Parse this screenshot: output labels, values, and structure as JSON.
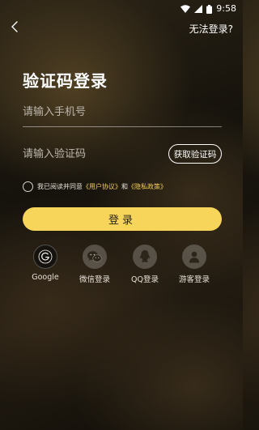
{
  "status_bar": {
    "time": "9:58"
  },
  "header": {
    "back_icon": "chevron-left-icon",
    "cant_login": "无法登录?"
  },
  "title": "验证码登录",
  "phone": {
    "placeholder": "请输入手机号",
    "value": ""
  },
  "code": {
    "placeholder": "请输入验证码",
    "value": "",
    "get_code_label": "获取验证码"
  },
  "agreement": {
    "checked": false,
    "prefix": "我已阅读并同意",
    "user_agreement": "《用户协议》",
    "and": "和",
    "privacy_policy": "《隐私政策》"
  },
  "login_button": "登录",
  "social_logins": [
    {
      "label": "Google",
      "icon": "google-icon"
    },
    {
      "label": "微信登录",
      "icon": "wechat-icon"
    },
    {
      "label": "QQ登录",
      "icon": "qq-icon"
    },
    {
      "label": "游客登录",
      "icon": "guest-user-icon"
    }
  ],
  "colors": {
    "accent": "#f7d55a",
    "link": "#f1cc58",
    "background": "#1a150e"
  }
}
